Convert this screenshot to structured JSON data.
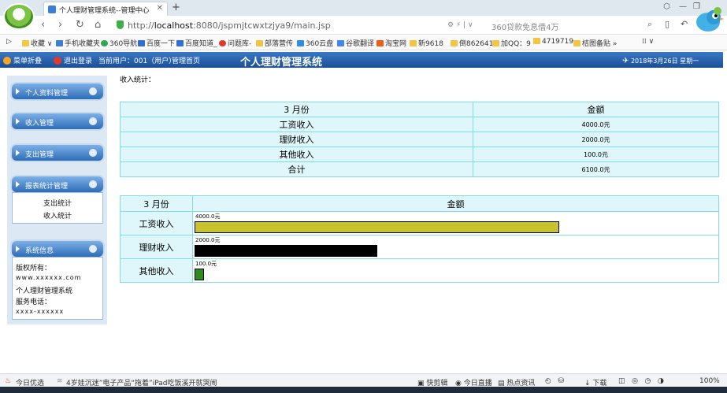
{
  "browser": {
    "tab_title": "个人理财管理系统--管理中心",
    "url_host": "localhost",
    "url_rest": ":8080/jspmjtcwxtzjya9/main.jsp",
    "url_prefix": "http://",
    "search_placeholder": "360贷款免息借4万",
    "bookmarks": [
      "收藏",
      "手机收藏夹",
      "360导航",
      "百度一下",
      "百度知道_",
      "问题库-",
      "部落营传",
      "360云盘",
      "谷歌翻译",
      "淘宝网",
      "新9618",
      "倒862641",
      "加QQ：9",
      "4719719",
      "桔图备贴"
    ],
    "status_left": [
      "今日优选",
      "4岁娃沉迷”电子产品“拖着”iPad吃饭溪开就哭闹"
    ],
    "status_right": [
      "快剪辑",
      "今日直播",
      "热点资讯",
      "下载",
      "100%"
    ]
  },
  "app": {
    "header_links": [
      "菜单折叠",
      "退出登录"
    ],
    "current_user": "当前用户：001（用户）",
    "admin_home": "管理首页",
    "title": "个人理财管理系统",
    "date": "2018年3月26日 星期一"
  },
  "sidebar": {
    "menus": [
      "个人资料管理",
      "收入管理",
      "支出管理",
      "报表统计管理"
    ],
    "report_items": [
      "支出统计",
      "收入统计"
    ],
    "info_title": "系统信息",
    "info_lines": [
      "版权所有：",
      "www.xxxxxx.com",
      "个人理财管理系统",
      "服务电话：",
      "xxxx-xxxxxx"
    ]
  },
  "main": {
    "caption": "收入统计：",
    "table": {
      "headers": [
        "3 月份",
        "金额"
      ],
      "rows": [
        {
          "label": "工资收入",
          "amount": "4000.0元"
        },
        {
          "label": "理财收入",
          "amount": "2000.0元"
        },
        {
          "label": "其他收入",
          "amount": "100.0元"
        },
        {
          "label": "合计",
          "amount": "6100.0元"
        }
      ]
    }
  },
  "chart_data": {
    "type": "bar",
    "orientation": "horizontal",
    "headers": [
      "3 月份",
      "金额"
    ],
    "categories": [
      "工资收入",
      "理财收入",
      "其他收入"
    ],
    "values": [
      4000.0,
      2000.0,
      100.0
    ],
    "value_labels": [
      "4000.0元",
      "2000.0元",
      "100.0元"
    ],
    "colors": [
      "#c9c22f",
      "#000000",
      "#2e8b1f"
    ]
  }
}
